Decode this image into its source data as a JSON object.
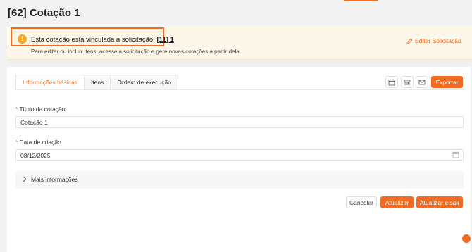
{
  "page": {
    "title": "[62] Cotação 1"
  },
  "alert": {
    "icon": "exclamation-icon",
    "text_prefix": "Esta cotação está vinculada a solicitação: ",
    "link": "[11] 1",
    "subtext": "Para editar ou incluir itens, acesse a solicitação e gere novas cotações a partir dela.",
    "edit_label": "Editar Solicitação"
  },
  "tabs": [
    {
      "label": "Informações básicas",
      "active": true
    },
    {
      "label": "Itens",
      "active": false
    },
    {
      "label": "Ordem de execução",
      "active": false
    }
  ],
  "toolbar": {
    "icons": [
      "calendar-icon",
      "grid-list-icon",
      "mail-icon"
    ],
    "export_label": "Exportar"
  },
  "form": {
    "title_label": "Título da cotação",
    "title_value": "Cotação 1",
    "date_label": "Data de criação",
    "date_value": "08/12/2025"
  },
  "more": {
    "label": "Mais informações"
  },
  "actions": {
    "cancel_label": "Cancelar",
    "update_label": "Atualizar",
    "update_exit_label": "Atualizar e sair"
  },
  "colors": {
    "accent": "#f26b22",
    "alert_bg": "#fdf7e9",
    "warning": "#f5a623"
  }
}
